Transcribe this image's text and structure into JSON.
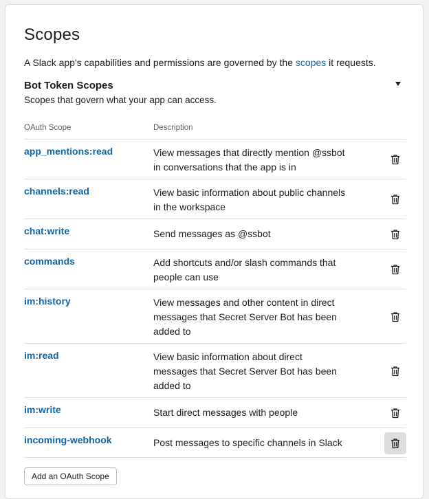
{
  "page": {
    "title": "Scopes",
    "intro_before": "A Slack app's capabilities and permissions are governed by the ",
    "intro_link": "scopes",
    "intro_after": " it requests."
  },
  "bot_scopes": {
    "title": "Bot Token Scopes",
    "subtitle": "Scopes that govern what your app can access.",
    "col_scope": "OAuth Scope",
    "col_description": "Description",
    "rows": [
      {
        "scope": "app_mentions:read",
        "desc1": "View messages that directly mention @ssbot",
        "desc2": "in conversations that the app is in",
        "desc3": ""
      },
      {
        "scope": "channels:read",
        "desc1": "View basic information about public channels",
        "desc2": "in the workspace",
        "desc3": ""
      },
      {
        "scope": "chat:write",
        "desc1": "Send messages as @ssbot",
        "desc2": "",
        "desc3": ""
      },
      {
        "scope": "commands",
        "desc1": "Add shortcuts and/or slash commands that",
        "desc2": "people can use",
        "desc3": ""
      },
      {
        "scope": "im:history",
        "desc1": "View messages and other content in direct",
        "desc2": "messages that Secret Server Bot has been",
        "desc3": "added to"
      },
      {
        "scope": "im:read",
        "desc1": "View basic information about direct",
        "desc2": "messages that Secret Server Bot has been",
        "desc3": "added to"
      },
      {
        "scope": "im:write",
        "desc1": "Start direct messages with people",
        "desc2": "",
        "desc3": ""
      },
      {
        "scope": "incoming-webhook",
        "desc1": "Post messages to specific channels in Slack",
        "desc2": "",
        "desc3": ""
      }
    ],
    "add_button": "Add an OAuth Scope"
  },
  "icons": {
    "delete": "trash-icon",
    "toggle": "caret-down-icon"
  },
  "colors": {
    "link": "#1264a3",
    "text": "#1d1c1d",
    "muted": "#616061",
    "hover_bg": "#dddddd"
  }
}
